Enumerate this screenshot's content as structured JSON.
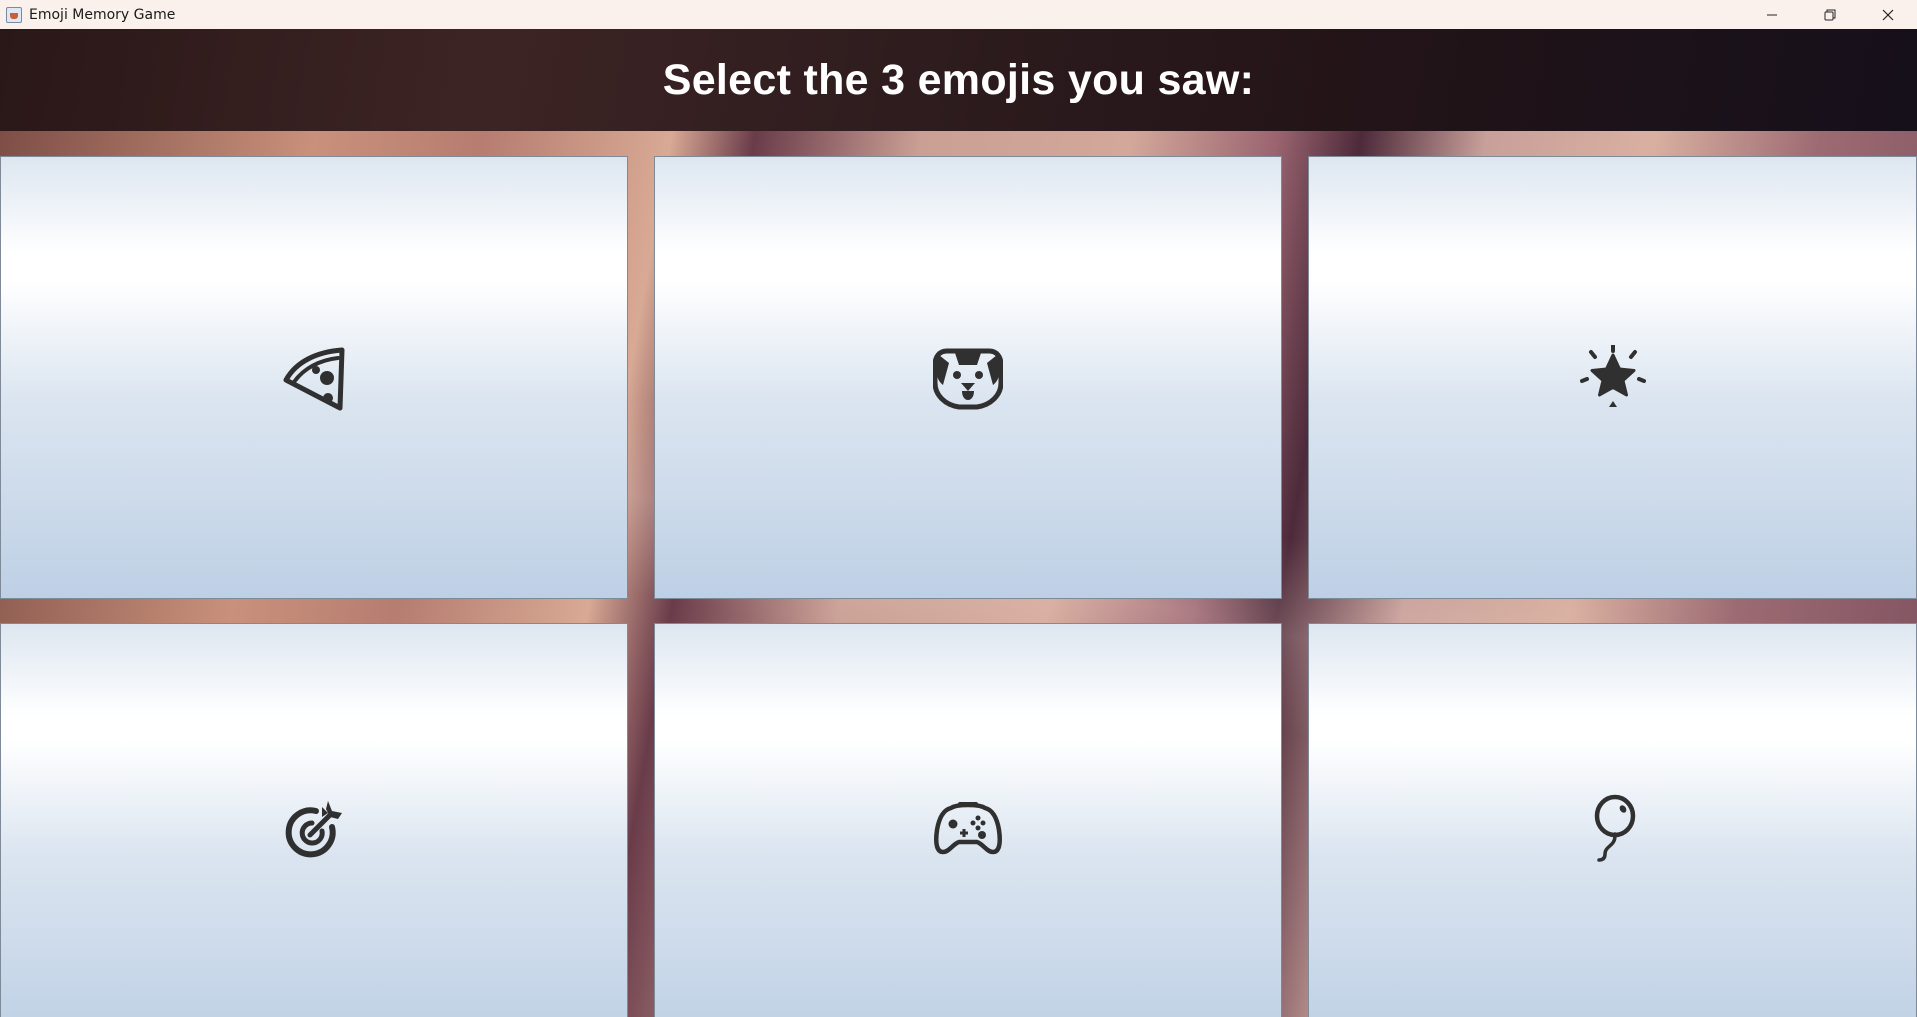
{
  "window": {
    "title": "Emoji Memory Game",
    "controls": {
      "minimize": "—",
      "restore": "❐",
      "close": "✕"
    }
  },
  "header": {
    "prompt": "Select the 3 emojis you saw:"
  },
  "cards": [
    {
      "icon": "pizza-icon"
    },
    {
      "icon": "dog-face-icon"
    },
    {
      "icon": "glowing-star-icon"
    },
    {
      "icon": "bullseye-dart-icon"
    },
    {
      "icon": "game-controller-icon"
    },
    {
      "icon": "balloon-icon"
    }
  ],
  "colors": {
    "header_bg": "#2e1c1e",
    "card_top": "#ffffff",
    "card_bottom": "#bed0e5",
    "icon": "#303030"
  }
}
